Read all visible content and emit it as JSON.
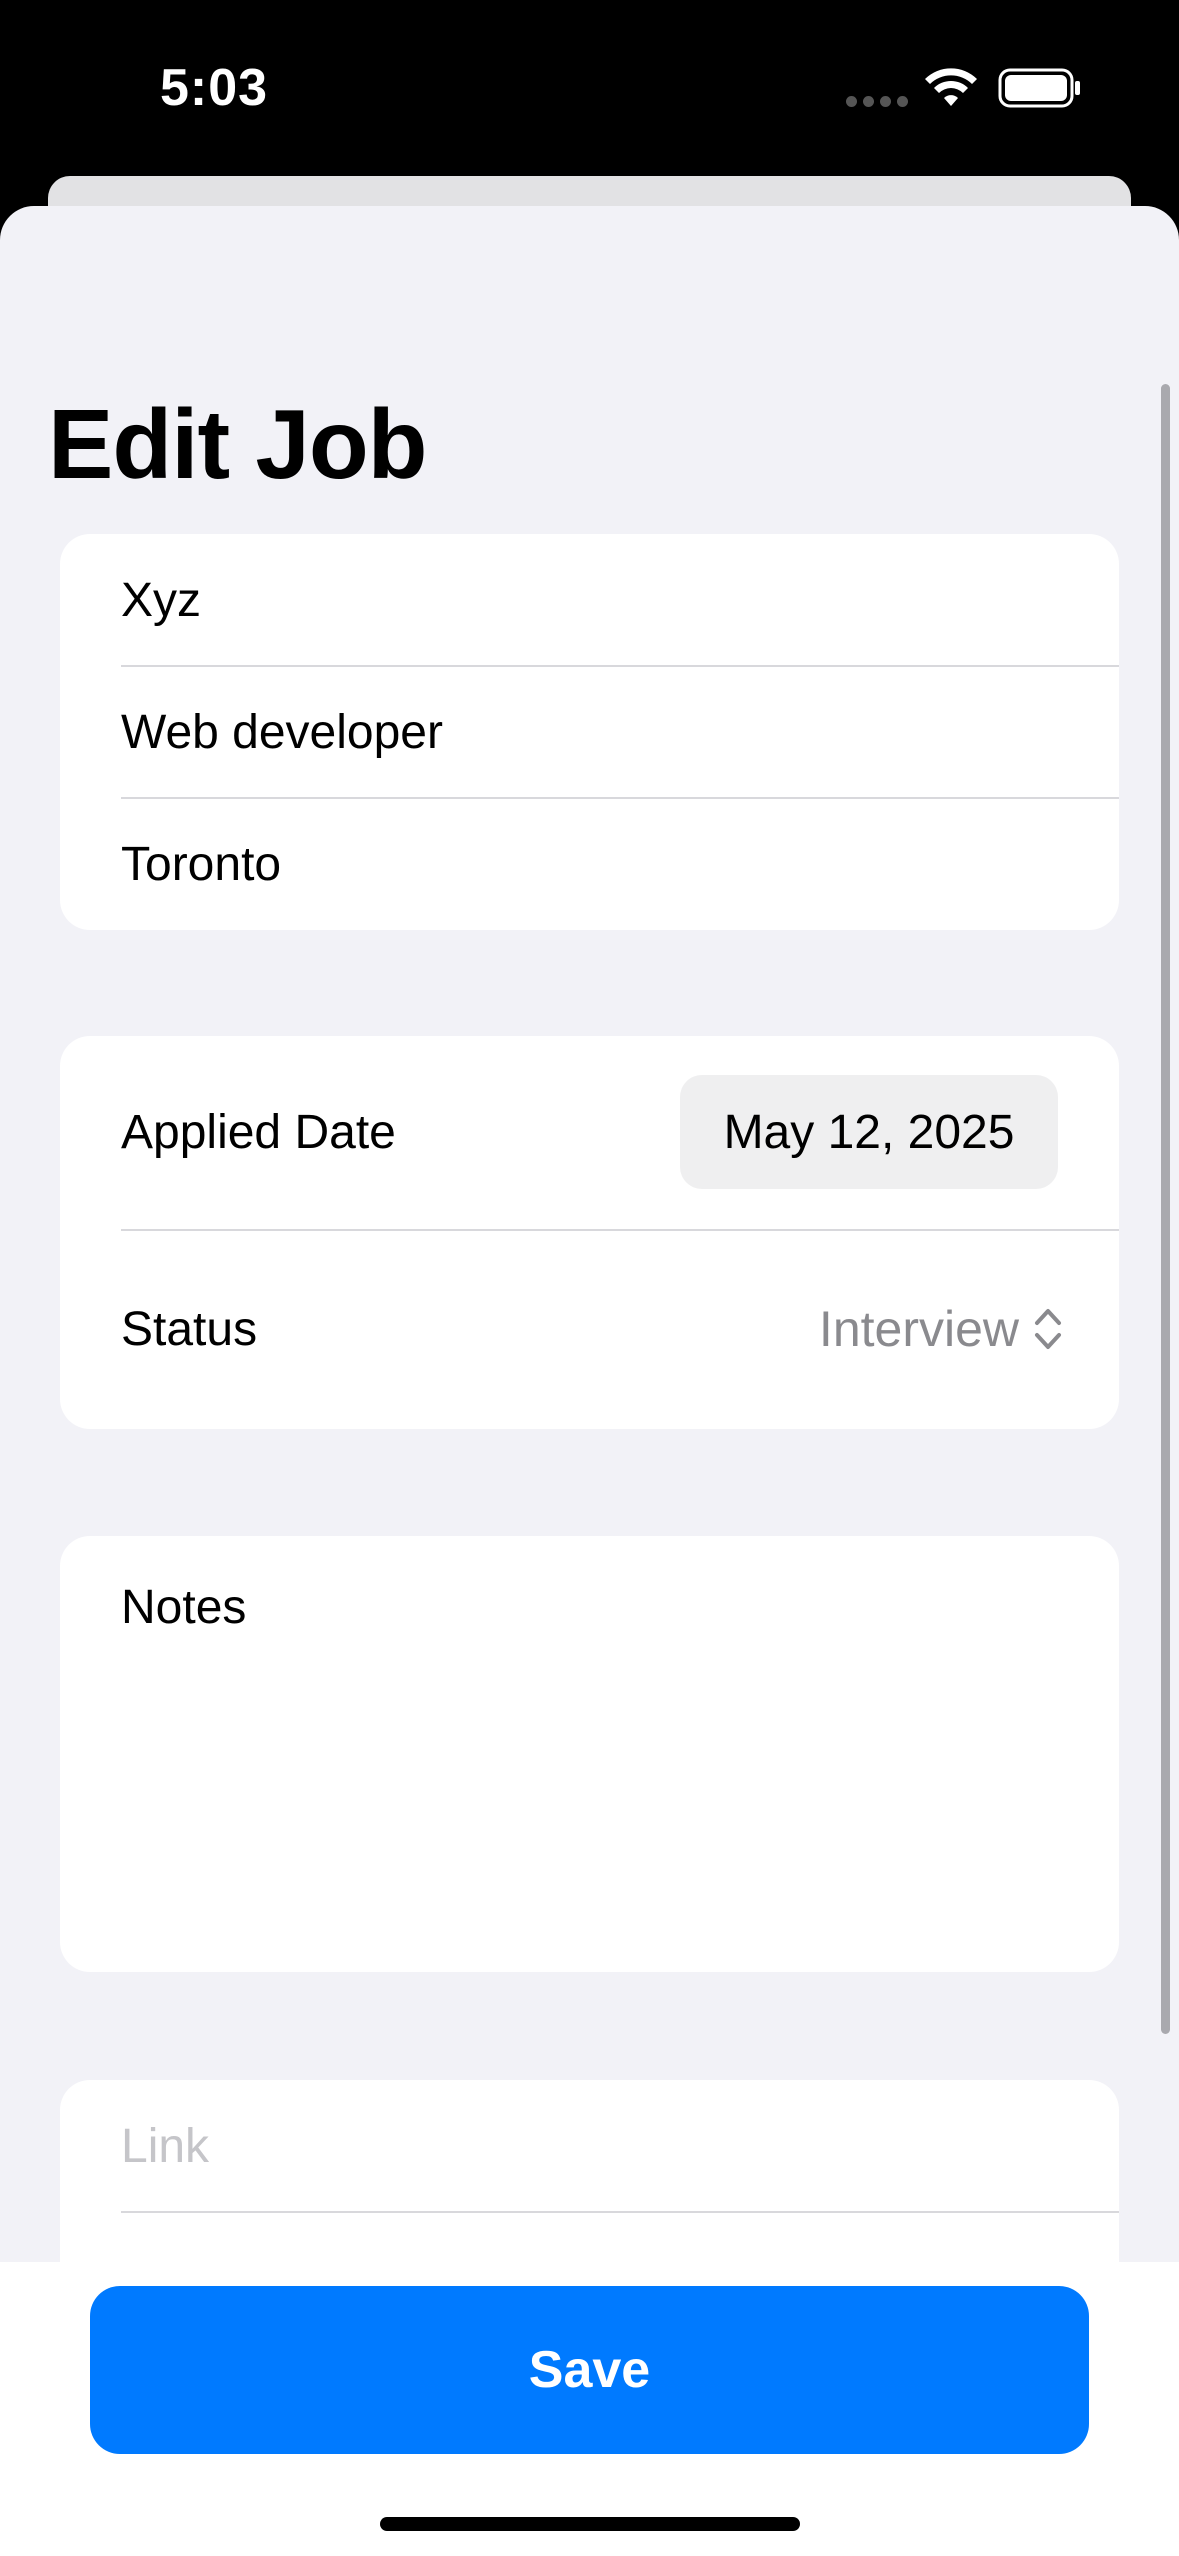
{
  "status_bar": {
    "time": "5:03",
    "icons": [
      "cellular-dots-icon",
      "wifi-icon",
      "battery-icon"
    ]
  },
  "sheet": {
    "title": "Edit Job"
  },
  "job_info": {
    "company": "Xyz",
    "position": "Web developer",
    "location": "Toronto"
  },
  "details": {
    "applied_date_label": "Applied Date",
    "applied_date_value": "May 12, 2025",
    "status_label": "Status",
    "status_value": "Interview"
  },
  "notes": {
    "placeholder": "Notes"
  },
  "link": {
    "placeholder": "Link"
  },
  "footer": {
    "save_label": "Save"
  },
  "colors": {
    "accent": "#007aff",
    "background": "#f2f2f7",
    "card": "#ffffff",
    "secondary_text": "#8a8a8e",
    "placeholder": "#c5c5c9"
  }
}
